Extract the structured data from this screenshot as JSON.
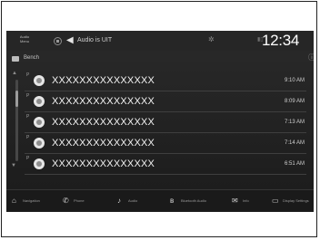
{
  "status_bar": {
    "small_label": "Audio Menu",
    "source_title": "Audio is UIT",
    "time": "12:34"
  },
  "sub_header": {
    "title": "Bench",
    "info_glyph": "ⓘ"
  },
  "icons": {
    "grid": "grid-icon",
    "speaker": "speaker-icon",
    "gear": "gear-icon",
    "signal": "signal-bars-icon",
    "folder": "folder-icon",
    "info": "info-icon",
    "up": "scroll-up-icon",
    "down": "scroll-down-icon",
    "row": "disc-icon"
  },
  "list": {
    "items": [
      {
        "name": "XXXXXXXXXXXXXXX",
        "time": "9:10 AM",
        "flag": "P"
      },
      {
        "name": "XXXXXXXXXXXXXXX",
        "time": "8:09 AM",
        "flag": "P"
      },
      {
        "name": "XXXXXXXXXXXXXXX",
        "time": "7:13 AM",
        "flag": "P"
      },
      {
        "name": "XXXXXXXXXXXXXXX",
        "time": "7:14 AM",
        "flag": "P"
      },
      {
        "name": "XXXXXXXXXXXXXXX",
        "time": "6:51 AM",
        "flag": "P"
      }
    ]
  },
  "nav": {
    "items": [
      {
        "icon": "⌂",
        "label": "Navigation"
      },
      {
        "icon": "✆",
        "label": "Phone"
      },
      {
        "icon": "♪",
        "label": "Audio"
      },
      {
        "icon": "ʙ",
        "label": "Bluetooth Audio"
      },
      {
        "icon": "✉",
        "label": "Info"
      },
      {
        "icon": "▭",
        "label": "Display Settings"
      }
    ]
  },
  "colors": {
    "screen_top": "#2a2a2a",
    "screen_bottom": "#1b1b1b",
    "text_primary": "#f3f3f3",
    "text_secondary": "#cfcfcf"
  }
}
